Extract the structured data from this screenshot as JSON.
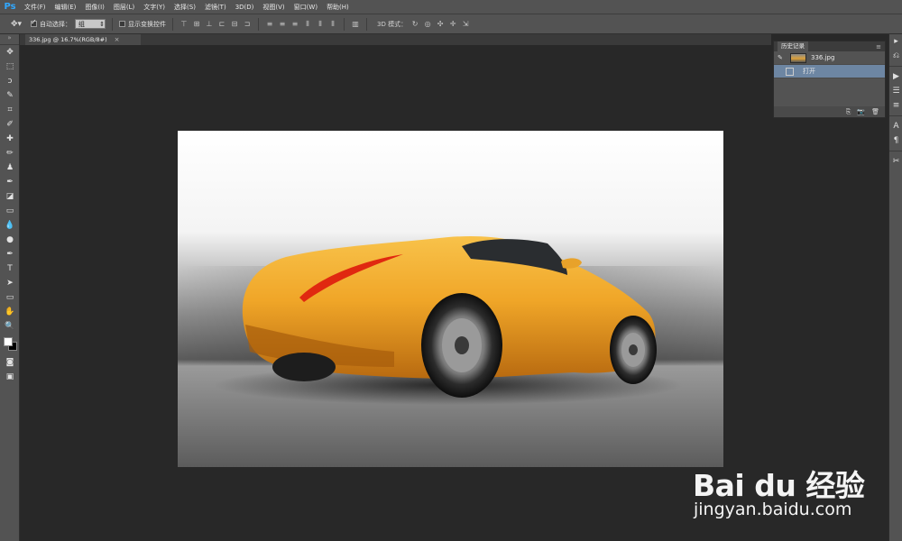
{
  "app": {
    "logo": "Ps"
  },
  "menu": [
    "文件(F)",
    "编辑(E)",
    "图像(I)",
    "图层(L)",
    "文字(Y)",
    "选择(S)",
    "滤镜(T)",
    "3D(D)",
    "视图(V)",
    "窗口(W)",
    "帮助(H)"
  ],
  "options": {
    "auto_select_label": "自动选择：",
    "auto_select_value": "组",
    "show_transform_label": "显示变换控件",
    "mode3d_label": "3D 模式："
  },
  "document": {
    "tab_title": "336.jpg @ 16.7%(RGB/8#)",
    "close": "×"
  },
  "history": {
    "tab_label": "历史记录",
    "items": [
      {
        "label": "336.jpg",
        "selected": false
      },
      {
        "label": "打开",
        "selected": true
      }
    ]
  },
  "watermark": {
    "logo_text": "Bai du 经验",
    "site": "jingyan.baidu.com"
  },
  "colors": {
    "ui_bg": "#535353",
    "canvas_bg": "#282828",
    "accent": "#31a8ff",
    "selected_row": "#6d86a3"
  }
}
